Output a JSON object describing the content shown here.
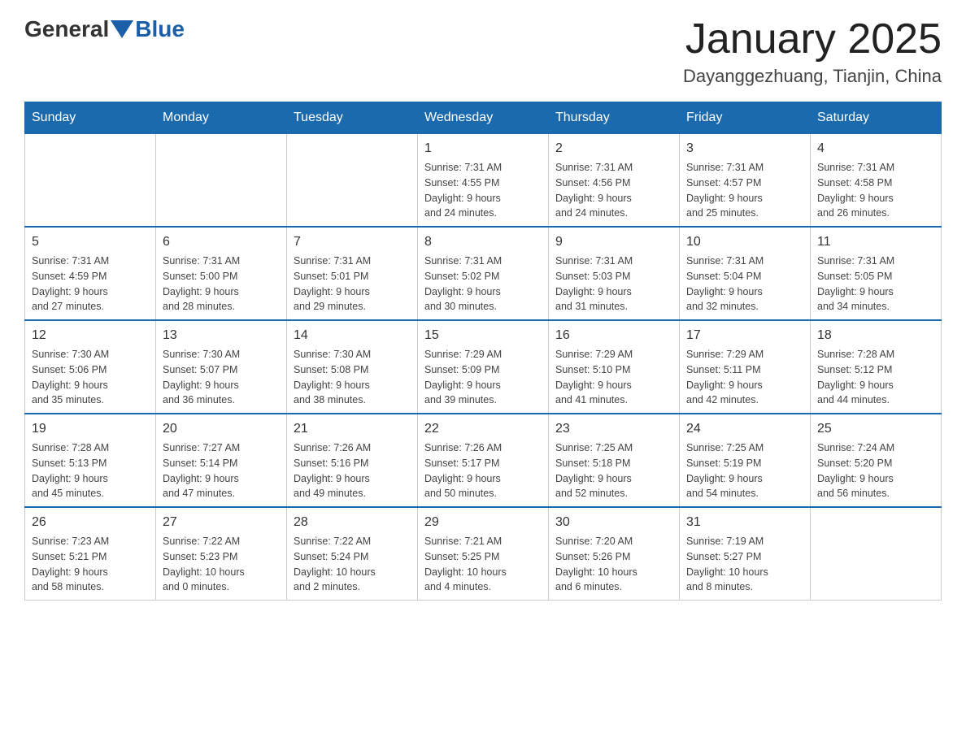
{
  "header": {
    "logo_general": "General",
    "logo_blue": "Blue",
    "month_title": "January 2025",
    "location": "Dayanggezhuang, Tianjin, China"
  },
  "weekdays": [
    "Sunday",
    "Monday",
    "Tuesday",
    "Wednesday",
    "Thursday",
    "Friday",
    "Saturday"
  ],
  "weeks": [
    [
      {
        "day": "",
        "info": ""
      },
      {
        "day": "",
        "info": ""
      },
      {
        "day": "",
        "info": ""
      },
      {
        "day": "1",
        "info": "Sunrise: 7:31 AM\nSunset: 4:55 PM\nDaylight: 9 hours\nand 24 minutes."
      },
      {
        "day": "2",
        "info": "Sunrise: 7:31 AM\nSunset: 4:56 PM\nDaylight: 9 hours\nand 24 minutes."
      },
      {
        "day": "3",
        "info": "Sunrise: 7:31 AM\nSunset: 4:57 PM\nDaylight: 9 hours\nand 25 minutes."
      },
      {
        "day": "4",
        "info": "Sunrise: 7:31 AM\nSunset: 4:58 PM\nDaylight: 9 hours\nand 26 minutes."
      }
    ],
    [
      {
        "day": "5",
        "info": "Sunrise: 7:31 AM\nSunset: 4:59 PM\nDaylight: 9 hours\nand 27 minutes."
      },
      {
        "day": "6",
        "info": "Sunrise: 7:31 AM\nSunset: 5:00 PM\nDaylight: 9 hours\nand 28 minutes."
      },
      {
        "day": "7",
        "info": "Sunrise: 7:31 AM\nSunset: 5:01 PM\nDaylight: 9 hours\nand 29 minutes."
      },
      {
        "day": "8",
        "info": "Sunrise: 7:31 AM\nSunset: 5:02 PM\nDaylight: 9 hours\nand 30 minutes."
      },
      {
        "day": "9",
        "info": "Sunrise: 7:31 AM\nSunset: 5:03 PM\nDaylight: 9 hours\nand 31 minutes."
      },
      {
        "day": "10",
        "info": "Sunrise: 7:31 AM\nSunset: 5:04 PM\nDaylight: 9 hours\nand 32 minutes."
      },
      {
        "day": "11",
        "info": "Sunrise: 7:31 AM\nSunset: 5:05 PM\nDaylight: 9 hours\nand 34 minutes."
      }
    ],
    [
      {
        "day": "12",
        "info": "Sunrise: 7:30 AM\nSunset: 5:06 PM\nDaylight: 9 hours\nand 35 minutes."
      },
      {
        "day": "13",
        "info": "Sunrise: 7:30 AM\nSunset: 5:07 PM\nDaylight: 9 hours\nand 36 minutes."
      },
      {
        "day": "14",
        "info": "Sunrise: 7:30 AM\nSunset: 5:08 PM\nDaylight: 9 hours\nand 38 minutes."
      },
      {
        "day": "15",
        "info": "Sunrise: 7:29 AM\nSunset: 5:09 PM\nDaylight: 9 hours\nand 39 minutes."
      },
      {
        "day": "16",
        "info": "Sunrise: 7:29 AM\nSunset: 5:10 PM\nDaylight: 9 hours\nand 41 minutes."
      },
      {
        "day": "17",
        "info": "Sunrise: 7:29 AM\nSunset: 5:11 PM\nDaylight: 9 hours\nand 42 minutes."
      },
      {
        "day": "18",
        "info": "Sunrise: 7:28 AM\nSunset: 5:12 PM\nDaylight: 9 hours\nand 44 minutes."
      }
    ],
    [
      {
        "day": "19",
        "info": "Sunrise: 7:28 AM\nSunset: 5:13 PM\nDaylight: 9 hours\nand 45 minutes."
      },
      {
        "day": "20",
        "info": "Sunrise: 7:27 AM\nSunset: 5:14 PM\nDaylight: 9 hours\nand 47 minutes."
      },
      {
        "day": "21",
        "info": "Sunrise: 7:26 AM\nSunset: 5:16 PM\nDaylight: 9 hours\nand 49 minutes."
      },
      {
        "day": "22",
        "info": "Sunrise: 7:26 AM\nSunset: 5:17 PM\nDaylight: 9 hours\nand 50 minutes."
      },
      {
        "day": "23",
        "info": "Sunrise: 7:25 AM\nSunset: 5:18 PM\nDaylight: 9 hours\nand 52 minutes."
      },
      {
        "day": "24",
        "info": "Sunrise: 7:25 AM\nSunset: 5:19 PM\nDaylight: 9 hours\nand 54 minutes."
      },
      {
        "day": "25",
        "info": "Sunrise: 7:24 AM\nSunset: 5:20 PM\nDaylight: 9 hours\nand 56 minutes."
      }
    ],
    [
      {
        "day": "26",
        "info": "Sunrise: 7:23 AM\nSunset: 5:21 PM\nDaylight: 9 hours\nand 58 minutes."
      },
      {
        "day": "27",
        "info": "Sunrise: 7:22 AM\nSunset: 5:23 PM\nDaylight: 10 hours\nand 0 minutes."
      },
      {
        "day": "28",
        "info": "Sunrise: 7:22 AM\nSunset: 5:24 PM\nDaylight: 10 hours\nand 2 minutes."
      },
      {
        "day": "29",
        "info": "Sunrise: 7:21 AM\nSunset: 5:25 PM\nDaylight: 10 hours\nand 4 minutes."
      },
      {
        "day": "30",
        "info": "Sunrise: 7:20 AM\nSunset: 5:26 PM\nDaylight: 10 hours\nand 6 minutes."
      },
      {
        "day": "31",
        "info": "Sunrise: 7:19 AM\nSunset: 5:27 PM\nDaylight: 10 hours\nand 8 minutes."
      },
      {
        "day": "",
        "info": ""
      }
    ]
  ]
}
